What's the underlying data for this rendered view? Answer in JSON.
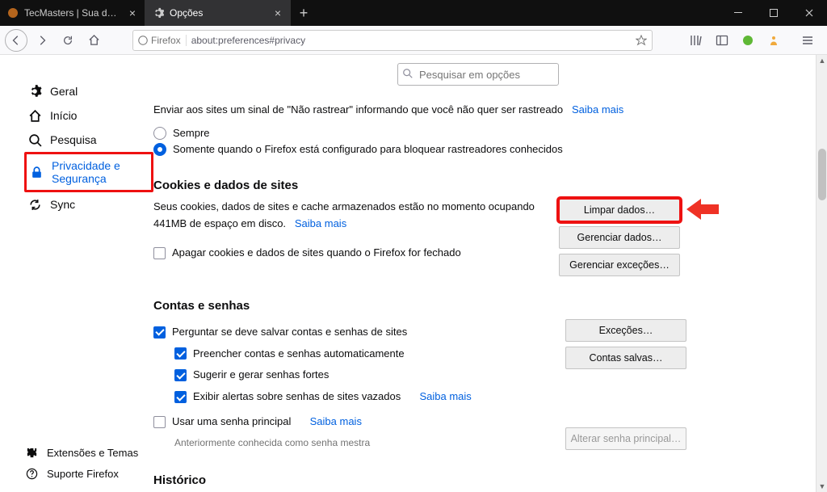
{
  "tabs": {
    "t0": {
      "label": "TecMasters | Sua dose diária de"
    },
    "t1": {
      "label": "Opções"
    }
  },
  "urlbar": {
    "identity": "Firefox",
    "url": "about:preferences#privacy"
  },
  "prefsearch": {
    "placeholder": "Pesquisar em opções"
  },
  "sidebar": {
    "geral": "Geral",
    "inicio": "Início",
    "pesquisa": "Pesquisa",
    "privacidade": "Privacidade e Segurança",
    "sync": "Sync",
    "extensoes": "Extensões e Temas",
    "suporte": "Suporte Firefox"
  },
  "dnt": {
    "intro": "Enviar aos sites um sinal de \"Não rastrear\" informando que você não quer ser rastreado",
    "saiba": "Saiba mais",
    "opt_sempre": "Sempre",
    "opt_config": "Somente quando o Firefox está configurado para bloquear rastreadores conhecidos"
  },
  "cookies": {
    "heading": "Cookies e dados de sites",
    "body1": "Seus cookies, dados de sites e cache armazenados estão no momento ocupando 441MB de espaço em disco.",
    "saiba": "Saiba mais",
    "clear_btn": "Limpar dados…",
    "manage_btn": "Gerenciar dados…",
    "except_btn": "Gerenciar exceções…",
    "delete_close": "Apagar cookies e dados de sites quando o Firefox for fechado"
  },
  "logins": {
    "heading": "Contas e senhas",
    "ask_save": "Perguntar se deve salvar contas e senhas de sites",
    "autofill": "Preencher contas e senhas automaticamente",
    "suggest": "Sugerir e gerar senhas fortes",
    "breach": "Exibir alertas sobre senhas de sites vazados",
    "breach_saiba": "Saiba mais",
    "primary": "Usar uma senha principal",
    "primary_saiba": "Saiba mais",
    "note": "Anteriormente conhecida como senha mestra",
    "except_btn": "Exceções…",
    "saved_btn": "Contas salvas…",
    "change_btn": "Alterar senha principal…"
  },
  "history": {
    "heading": "Histórico"
  }
}
